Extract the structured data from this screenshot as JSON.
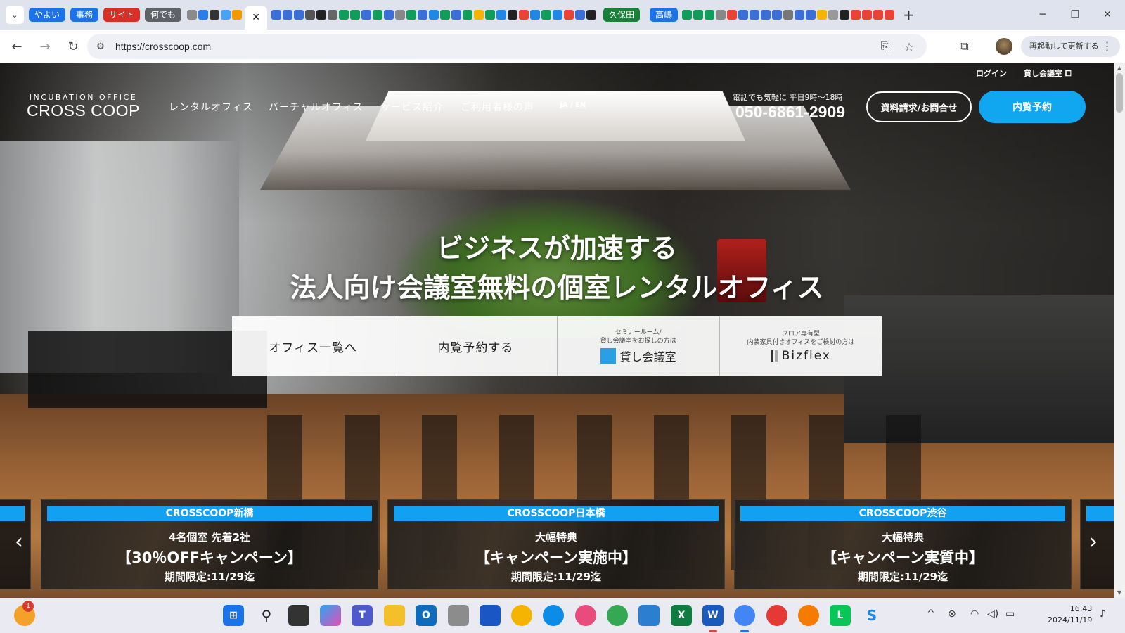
{
  "browser": {
    "tab_groups": [
      {
        "label": "やよい",
        "color": "#1a73e8"
      },
      {
        "label": "事務",
        "color": "#1a73e8"
      },
      {
        "label": "サイト",
        "color": "#d93025"
      },
      {
        "label": "何でも",
        "color": "#5f6368"
      }
    ],
    "tab_groups_right": [
      {
        "label": "久保田",
        "color": "#188038"
      },
      {
        "label": "高嶋",
        "color": "#1a73e8"
      }
    ],
    "active_tab_close": "✕",
    "new_tab": "+",
    "url": "https://crosscoop.com",
    "restart_label": "再起動して更新する"
  },
  "header": {
    "utility": {
      "login": "ログイン",
      "meeting_room": "貸し会議室"
    },
    "logo": {
      "top": "INCUBATION OFFICE",
      "main": "CROSS COOP"
    },
    "nav": [
      "レンタルオフィス",
      "バーチャルオフィス",
      "サービス紹介",
      "ご利用者様の声"
    ],
    "lang": {
      "ja": "JA",
      "sep": "/",
      "en": "EN"
    },
    "tel_note": "電話でも気軽に 平日9時〜18時",
    "tel": "050-6861-2909",
    "cta_docs": "資料請求/お問合せ",
    "cta_booking": "内覧予約"
  },
  "hero": {
    "line1": "ビジネスが加速する",
    "line2": "法人向け会議室無料の個室レンタルオフィス",
    "buttons": {
      "office_list": "オフィス一覧へ",
      "booking": "内覧予約する",
      "seminar_note1": "セミナールーム/",
      "seminar_note2": "貸し会議室をお探しの方は",
      "seminar_brand": "貸し会議室",
      "bizflex_note1": "フロア専有型",
      "bizflex_note2": "内装家具付きオフィスをご検討の方は",
      "bizflex_brand": "Bizflex"
    }
  },
  "campaigns": [
    {
      "tag": "CROSSCOOP新橋",
      "line1": "4名個室 先着2社",
      "line2": "【30％OFFキャンペーン】",
      "line3": "期間限定:11/29迄"
    },
    {
      "tag": "CROSSCOOP日本橋",
      "line1": "大幅特典",
      "line2": "【キャンペーン実施中】",
      "line3": "期間限定:11/29迄"
    },
    {
      "tag": "CROSSCOOP渋谷",
      "line1": "大幅特典",
      "line2": "【キャンペーン実質中】",
      "line3": "期間限定:11/29迄"
    }
  ],
  "taskbar": {
    "notification_count": "1",
    "time": "16:43",
    "date": "2024/11/19"
  }
}
